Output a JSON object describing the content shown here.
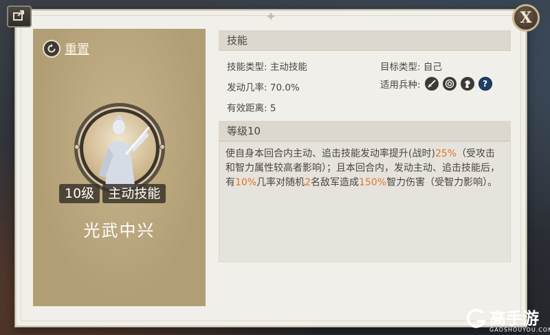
{
  "reset_label": "重置",
  "close_label": "X",
  "card": {
    "level_badge": "10级",
    "type_badge": "主动技能",
    "skill_name": "光武中兴"
  },
  "skill_section": {
    "header": "技能",
    "skill_type_label": "技能类型:",
    "skill_type_value": "主动技能",
    "target_type_label": "目标类型:",
    "target_type_value": "自己",
    "activation_rate_label": "发动几率:",
    "activation_rate_value": "70.0%",
    "applicable_arms_label": "适用兵种:",
    "applicable_arms": [
      "sword-icon",
      "bow-target-icon",
      "horse-icon",
      "question-icon"
    ],
    "range_label": "有效距离:",
    "range_value": "5"
  },
  "level_section": {
    "header": "等级10",
    "desc_parts": [
      {
        "t": "使自身本回合内主动、追击技能发动率提升(战时)",
        "h": false
      },
      {
        "t": "25%",
        "h": true
      },
      {
        "t": "（受攻击和智力属性较高者影响）；且本回合内，发动主动、追击技能后，有",
        "h": false
      },
      {
        "t": "10%",
        "h": true
      },
      {
        "t": "几率对随机",
        "h": false
      },
      {
        "t": "2",
        "h": true
      },
      {
        "t": "名敌军造成",
        "h": false
      },
      {
        "t": "150%",
        "h": true
      },
      {
        "t": "智力伤害（受智力影响）。",
        "h": false
      }
    ]
  },
  "watermark": {
    "text": "高手游",
    "url": "GAOSHOUYOU.COM"
  },
  "colors": {
    "highlight": "#e0742b",
    "card_bg": "#b7a37a"
  }
}
